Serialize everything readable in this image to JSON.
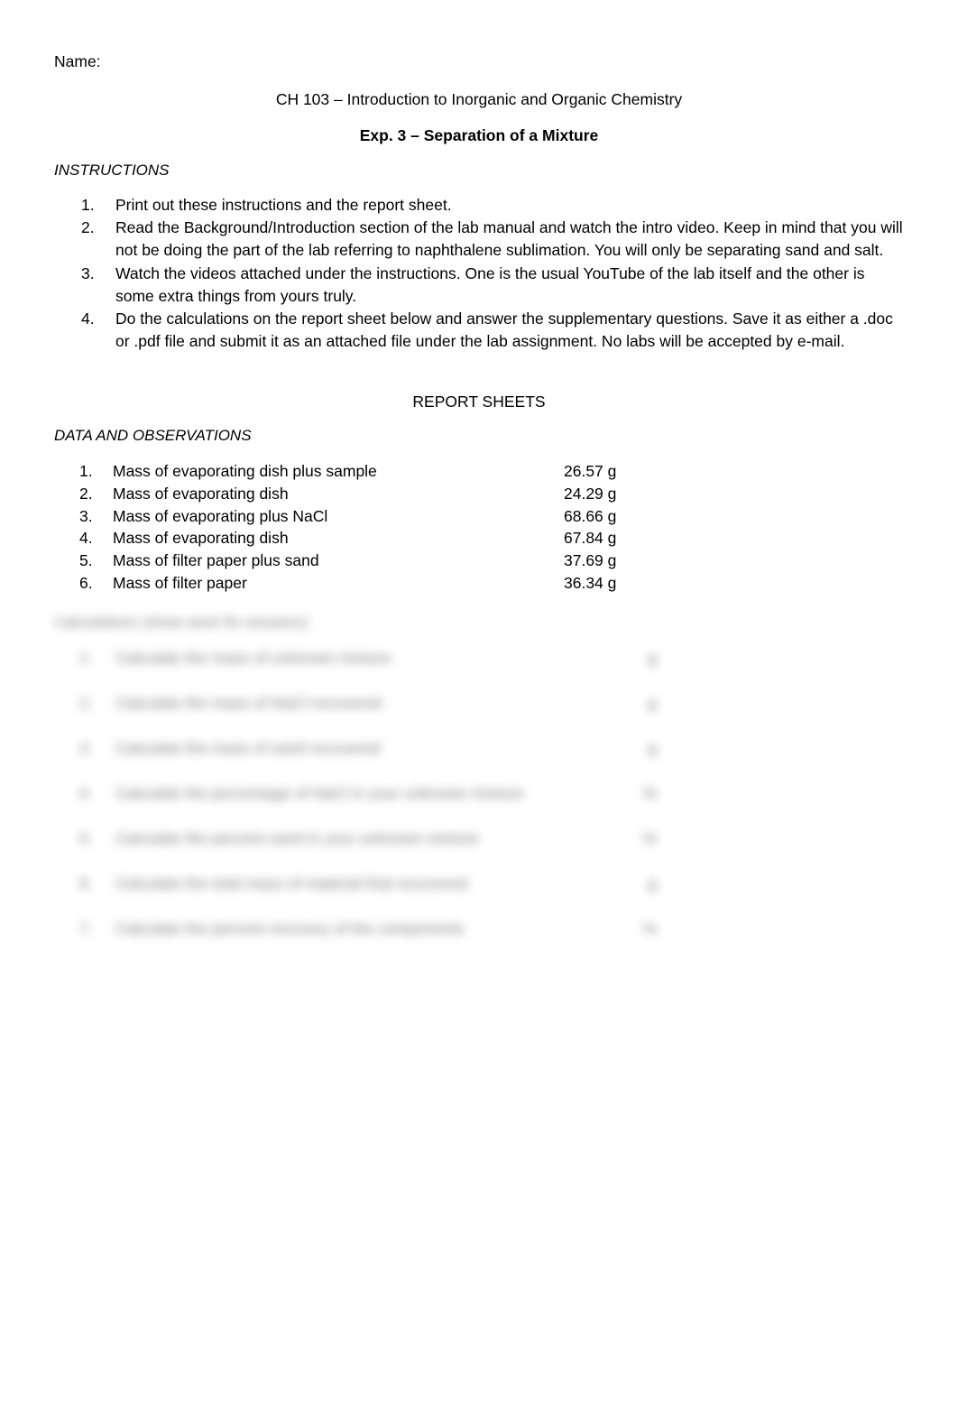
{
  "document": {
    "name_line": "Name:",
    "course_title": "CH 103 – Introduction to Inorganic and Organic Chemistry",
    "experiment_title": "Exp. 3 – Separation of a Mixture",
    "report_sheets_heading": "REPORT SHEETS"
  },
  "instructions": {
    "label": "INSTRUCTIONS",
    "items": [
      {
        "num": "1.",
        "text": "Print out these instructions and the report sheet."
      },
      {
        "num": "2.",
        "text": "Read the Background/Introduction section of the lab manual and watch the intro video.  Keep in mind that you will not be doing the part of the lab referring to naphthalene sublimation.  You will only be separating sand and salt."
      },
      {
        "num": "3.",
        "text": "Watch the videos attached under the instructions.  One is the usual YouTube of the lab itself and the other is some extra things from yours truly."
      },
      {
        "num": "4.",
        "text": "Do the calculations on the report sheet below and answer the supplementary questions.  Save it as either a .doc or .pdf file and submit it as an attached file under the lab assignment.  No labs will be accepted by e-mail."
      }
    ]
  },
  "data_observations": {
    "label": "DATA AND OBSERVATIONS",
    "rows": [
      {
        "num": "1.",
        "label": "Mass of evaporating dish plus sample",
        "value": "26.57 g"
      },
      {
        "num": "2.",
        "label": "Mass of evaporating dish",
        "value": "24.29 g"
      },
      {
        "num": "3.",
        "label": "Mass of evaporating plus NaCl",
        "value": "68.66 g"
      },
      {
        "num": "4.",
        "label": "Mass of evaporating dish",
        "value": "67.84 g"
      },
      {
        "num": "5.",
        "label": "Mass of filter paper plus sand",
        "value": "37.69 g"
      },
      {
        "num": "6.",
        "label": "Mass of filter paper",
        "value": "36.34 g"
      }
    ]
  },
  "calculations": {
    "heading": "Calculations (show work for answers)",
    "rows": [
      {
        "num": "1.",
        "text": "Calculate the mass of unknown mixture",
        "unit": "g"
      },
      {
        "num": "2.",
        "text": "Calculate the mass of NaCl recovered",
        "unit": "g"
      },
      {
        "num": "3.",
        "text": "Calculate the mass of sand recovered",
        "unit": "g"
      },
      {
        "num": "4.",
        "text": "Calculate the percentage of NaCl in your unknown mixture",
        "unit": "%"
      },
      {
        "num": "5.",
        "text": "Calculate the percent sand in your unknown mixture",
        "unit": "%"
      },
      {
        "num": "6.",
        "text": "Calculate the total mass of material that recovered",
        "unit": "g"
      },
      {
        "num": "7.",
        "text": "Calculate the percent recovery of the components",
        "unit": "%"
      }
    ]
  }
}
